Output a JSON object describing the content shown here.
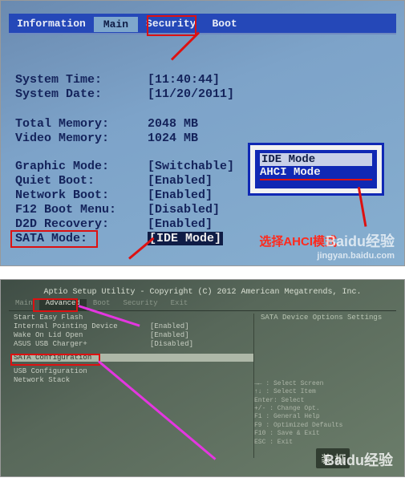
{
  "bios1": {
    "menu": {
      "info": "Information",
      "main": "Main",
      "security": "Security",
      "boot": "Boot"
    },
    "rows": {
      "time": {
        "label": "System Time:",
        "value": "[11:40:44]"
      },
      "date": {
        "label": "System Date:",
        "value": "[11/20/2011]"
      },
      "totalmem": {
        "label": "Total Memory:",
        "value": "2048 MB"
      },
      "videomem": {
        "label": "Video Memory:",
        "value": "1024 MB"
      },
      "graphic": {
        "label": "Graphic Mode:",
        "value": "[Switchable]"
      },
      "quiet": {
        "label": "Quiet Boot:",
        "value": "[Enabled]"
      },
      "network": {
        "label": "Network Boot:",
        "value": "[Enabled]"
      },
      "f12": {
        "label": "F12 Boot Menu:",
        "value": "[Disabled]"
      },
      "d2d": {
        "label": "D2D Recovery:",
        "value": "[Enabled]"
      },
      "sata": {
        "label": "SATA Mode:",
        "value": "[IDE Mode]"
      }
    },
    "popup": {
      "opt1": "IDE Mode",
      "opt2": "AHCI Mode"
    },
    "annotation": "选择AHCI模式",
    "watermark_big": "Baidu经验",
    "watermark_small": "jingyan.baidu.com"
  },
  "bios2": {
    "title": "Aptio Setup Utility - Copyright (C) 2012 American Megatrends, Inc.",
    "tabs": {
      "main": "Main",
      "advanced": "Advanced",
      "boot": "Boot",
      "security": "Security",
      "exit": "Exit"
    },
    "items": {
      "start_easy": {
        "k": "Start Easy Flash",
        "v": ""
      },
      "pointing": {
        "k": "Internal Pointing Device",
        "v": "[Enabled]"
      },
      "wake": {
        "k": "Wake On Lid Open",
        "v": "[Enabled]"
      },
      "asus_lock": {
        "k": "ASUS USB Charger+",
        "v": "[Disabled]"
      },
      "sata_conf": {
        "k": "SATA Configuration",
        "v": ""
      },
      "usb_conf": {
        "k": "USB Configuration",
        "v": ""
      },
      "net_stack": {
        "k": "Network Stack",
        "v": ""
      }
    },
    "right_title": "SATA Device Options Settings",
    "help": {
      "l1": "→← : Select Screen",
      "l2": "↑↓ : Select Item",
      "l3": "Enter: Select",
      "l4": "+/- : Change Opt.",
      "l5": "F1 : General Help",
      "l6": "F9 : Optimized Defaults",
      "l7": "F10 : Save & Exit",
      "l8": "ESC : Exit"
    },
    "watermark_big": "Baidu经验",
    "cn_caption": "装  机"
  }
}
